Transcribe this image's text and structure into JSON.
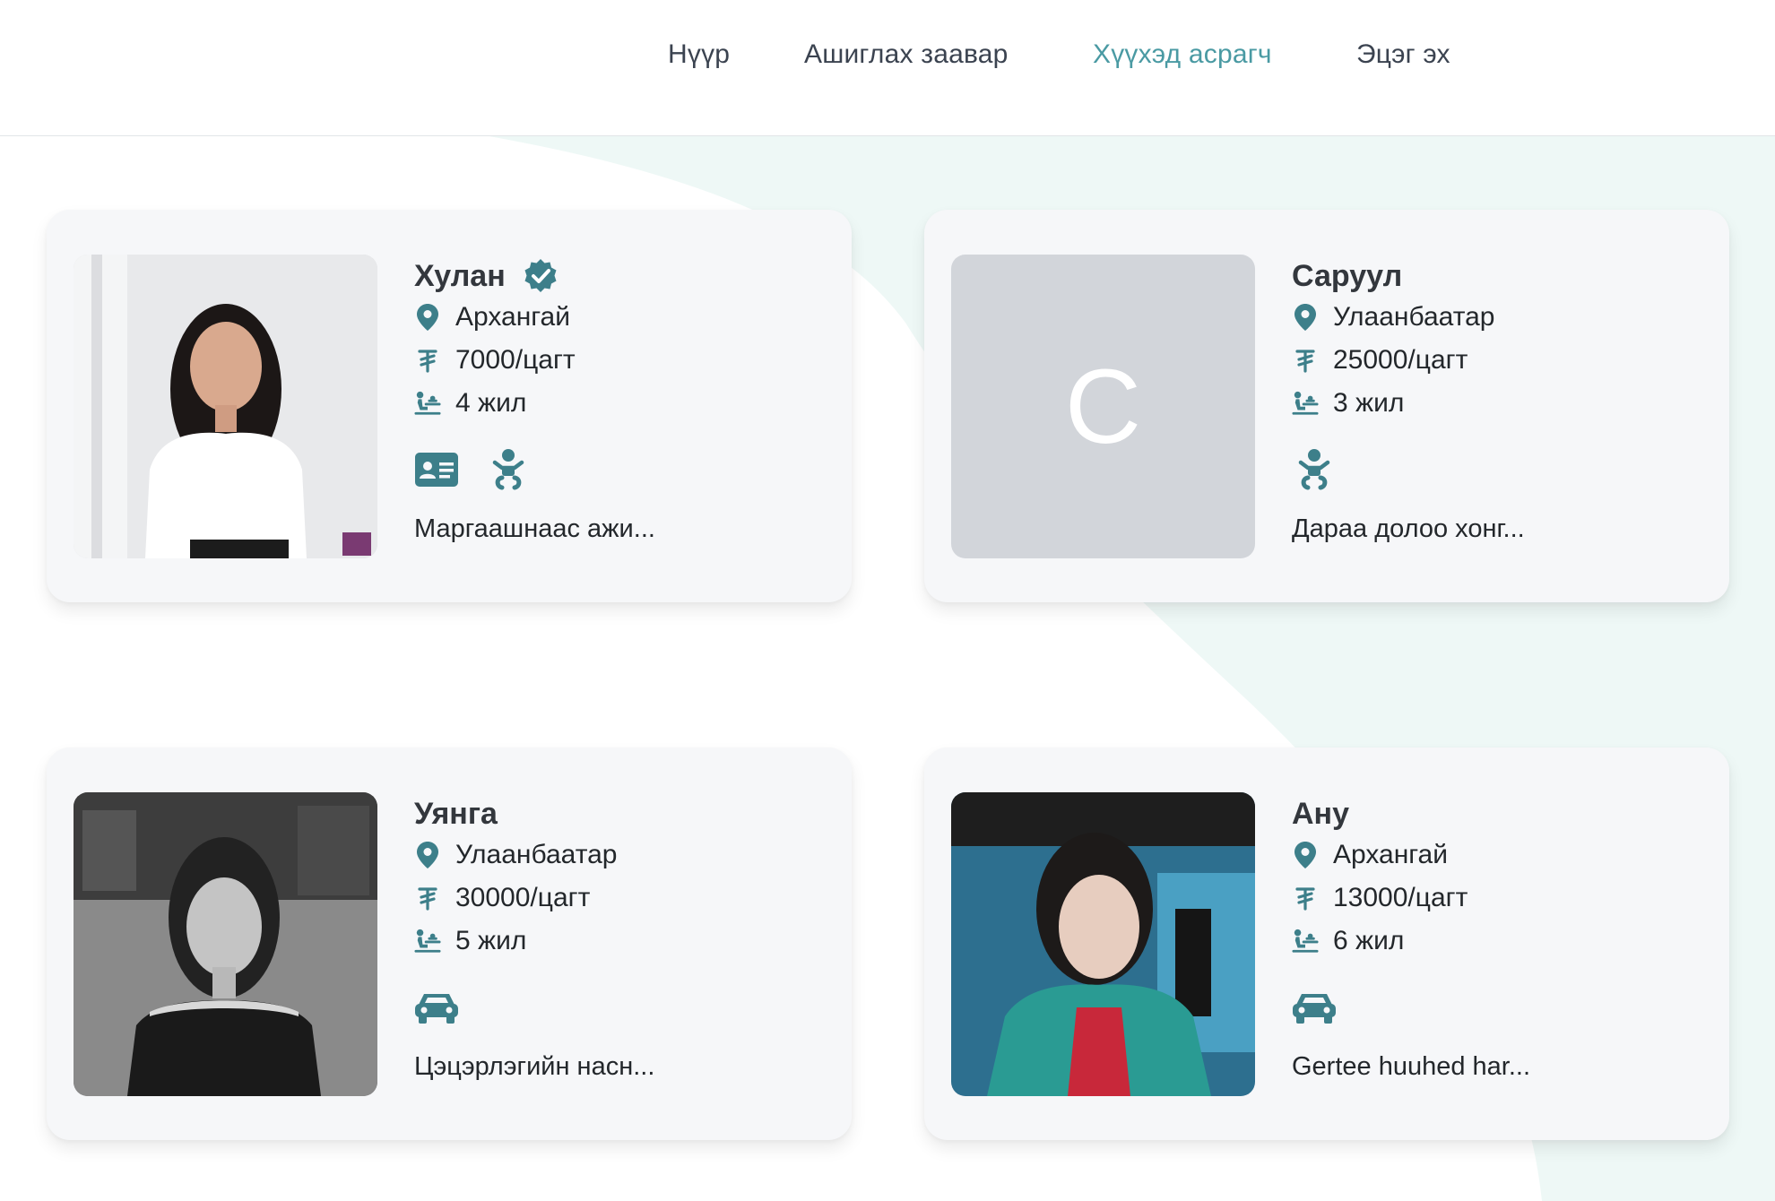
{
  "nav": {
    "items": [
      {
        "label": "Нүүр",
        "active": false
      },
      {
        "label": "Ашиглах заавар",
        "active": false
      },
      {
        "label": "Хүүхэд асрагч",
        "active": true
      },
      {
        "label": "Эцэг эх",
        "active": false
      }
    ]
  },
  "colors": {
    "accent": "#4a9aa3",
    "icon": "#3d7f8a",
    "card_bg": "#f6f7f9",
    "bg_shape": "#eef8f6",
    "placeholder": "#d2d5da"
  },
  "cards": [
    {
      "name": "Хулан",
      "verified": true,
      "location": "Архангай",
      "rate": "7000/цагт",
      "experience": "4 жил",
      "features": [
        "id-card-icon",
        "baby-icon"
      ],
      "description": "Маргаашнаас ажи...",
      "photo": "portrait-photo",
      "initial": ""
    },
    {
      "name": "Саруул",
      "verified": false,
      "location": "Улаанбаатар",
      "rate": "25000/цагт",
      "experience": "3 жил",
      "features": [
        "baby-icon"
      ],
      "description": "Дараа долоо хонг...",
      "photo": "placeholder",
      "initial": "С"
    },
    {
      "name": "Уянга",
      "verified": false,
      "location": "Улаанбаатар",
      "rate": "30000/цагт",
      "experience": "5 жил",
      "features": [
        "car-icon"
      ],
      "description": "Цэцэрлэгийн насн...",
      "photo": "portrait-photo-bw",
      "initial": ""
    },
    {
      "name": "Ану",
      "verified": false,
      "location": "Архангай",
      "rate": "13000/цагт",
      "experience": "6 жил",
      "features": [
        "car-icon"
      ],
      "description": "Gertee huuhed har...",
      "photo": "portrait-photo",
      "initial": ""
    }
  ]
}
